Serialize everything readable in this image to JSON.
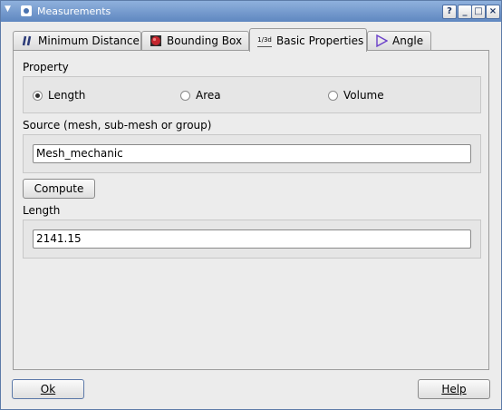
{
  "window": {
    "title": "Measurements"
  },
  "titlebar_buttons": {
    "help": "?",
    "minimize": "_",
    "maximize": "□",
    "close": "×"
  },
  "tabs": [
    {
      "label": "Minimum Distance",
      "icon": "min-distance-icon"
    },
    {
      "label": "Bounding Box",
      "icon": "bounding-box-icon"
    },
    {
      "label": "Basic Properties",
      "icon": "basic-properties-icon",
      "icon_text": "1/3d"
    },
    {
      "label": "Angle",
      "icon": "angle-icon"
    }
  ],
  "property": {
    "label": "Property",
    "options": [
      {
        "label": "Length",
        "checked": true
      },
      {
        "label": "Area",
        "checked": false
      },
      {
        "label": "Volume",
        "checked": false
      }
    ]
  },
  "source": {
    "label": "Source (mesh, sub-mesh or group)",
    "value": "Mesh_mechanic"
  },
  "compute": {
    "label": "Compute"
  },
  "result": {
    "label": "Length",
    "value": "2141.15"
  },
  "footer": {
    "ok_label": "Ok",
    "help_label": "Help"
  },
  "colors": {
    "title_bar": "#6f96cc",
    "angle_icon": "#6a3fc9",
    "bounding_icon": "#c4262e"
  }
}
